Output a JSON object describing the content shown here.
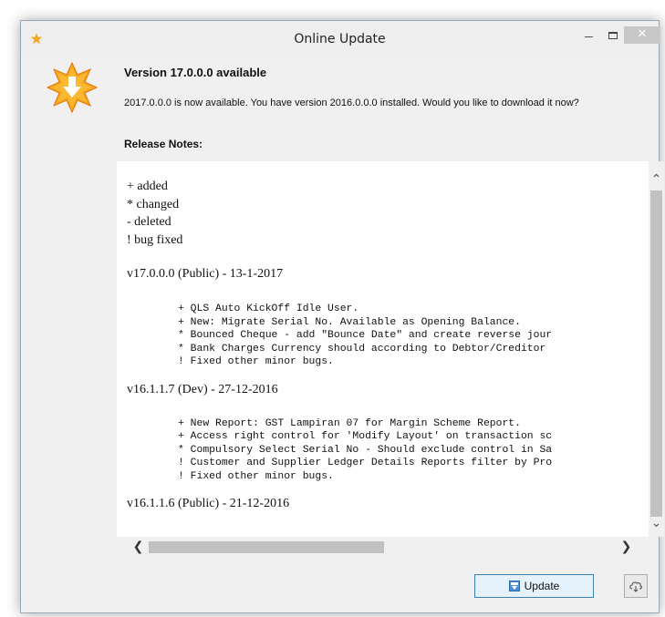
{
  "window": {
    "title": "Online Update"
  },
  "header": {
    "heading": "Version 17.0.0.0 available",
    "description": "2017.0.0.0 is now available. You have version 2016.0.0.0 installed. Would you like to download it now?",
    "release_notes_label": "Release Notes:"
  },
  "notes": {
    "legend": [
      "+ added",
      "* changed",
      "- deleted",
      "! bug fixed"
    ],
    "versions": [
      {
        "heading": "v17.0.0.0 (Public) - 13-1-2017",
        "lines": [
          "+ QLS Auto KickOff Idle User.",
          "+ New: Migrate Serial No. Available as Opening Balance.",
          "* Bounced Cheque - add \"Bounce Date\" and create reverse jour",
          "* Bank Charges Currency should according to Debtor/Creditor",
          "! Fixed other minor bugs."
        ]
      },
      {
        "heading": "v16.1.1.7 (Dev) - 27-12-2016",
        "lines": [
          "+ New Report: GST Lampiran 07 for Margin Scheme Report.",
          "+ Access right control for 'Modify Layout' on transaction sc",
          "* Compulsory Select Serial No - Should exclude control in Sa",
          "! Customer and Supplier Ledger Details Reports filter by Pro",
          "! Fixed other minor bugs."
        ]
      },
      {
        "heading": "v16.1.1.6 (Public) - 21-12-2016",
        "lines": []
      }
    ]
  },
  "buttons": {
    "update_label": "Update"
  },
  "colors": {
    "accent": "#3c7fb1",
    "icon_orange": "#f5a623"
  }
}
